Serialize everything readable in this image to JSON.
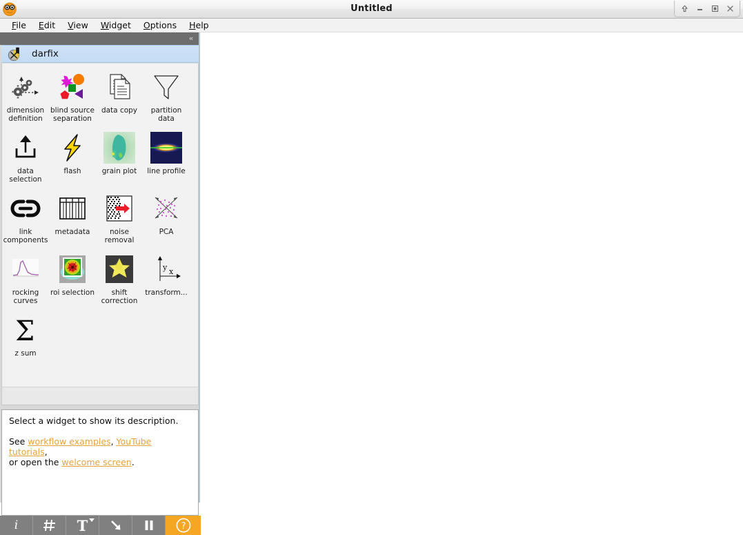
{
  "window": {
    "title": "Untitled",
    "logo_icon": "orange-canvas-smiley-icon",
    "controls": [
      {
        "name": "always-on-top-button",
        "glyph": "⬆",
        "icon": "arrow-up-icon"
      },
      {
        "name": "minimize-button",
        "glyph": "–",
        "icon": "minimize-icon"
      },
      {
        "name": "maximize-button",
        "glyph": "❒",
        "icon": "maximize-icon"
      },
      {
        "name": "close-button",
        "glyph": "✕",
        "icon": "close-icon"
      }
    ]
  },
  "menubar": {
    "items": [
      {
        "name": "menu-file",
        "mnemonic": "F",
        "rest": "ile"
      },
      {
        "name": "menu-edit",
        "mnemonic": "E",
        "rest": "dit"
      },
      {
        "name": "menu-view",
        "mnemonic": "V",
        "rest": "iew"
      },
      {
        "name": "menu-widget",
        "mnemonic": "W",
        "rest": "idget"
      },
      {
        "name": "menu-options",
        "mnemonic": "O",
        "rest": "ptions"
      },
      {
        "name": "menu-help",
        "mnemonic": "H",
        "rest": "elp"
      }
    ]
  },
  "toolbox": {
    "collapse_glyph": "«",
    "category": {
      "label": "darfix",
      "icon": "darfix-category-icon"
    },
    "widgets": [
      {
        "label": "dimension\ndefinition",
        "icon": "dimension-definition-icon"
      },
      {
        "label": "blind source\nseparation",
        "icon": "blind-source-separation-icon"
      },
      {
        "label": "data copy",
        "icon": "data-copy-icon"
      },
      {
        "label": "partition\ndata",
        "icon": "partition-data-icon"
      },
      {
        "label": "data\nselection",
        "icon": "data-selection-icon"
      },
      {
        "label": "flash",
        "icon": "flash-icon"
      },
      {
        "label": "grain plot",
        "icon": "grain-plot-icon"
      },
      {
        "label": "line profile",
        "icon": "line-profile-icon"
      },
      {
        "label": "link\ncomponents",
        "icon": "link-components-icon"
      },
      {
        "label": "metadata",
        "icon": "metadata-icon"
      },
      {
        "label": "noise\nremoval",
        "icon": "noise-removal-icon"
      },
      {
        "label": "PCA",
        "icon": "pca-icon"
      },
      {
        "label": "rocking\ncurves",
        "icon": "rocking-curves-icon"
      },
      {
        "label": "roi selection",
        "icon": "roi-selection-icon"
      },
      {
        "label": "shift\ncorrection",
        "icon": "shift-correction-icon"
      },
      {
        "label": "transform...",
        "icon": "transformation-icon"
      },
      {
        "label": "z sum",
        "icon": "z-sum-icon"
      }
    ]
  },
  "description": {
    "line1": "Select a widget to show its description.",
    "see_prefix": "See ",
    "link_workflow": "workflow examples",
    "sep1": ", ",
    "link_youtube": "YouTube tutorials",
    "sep2": ",",
    "or_prefix": "or open the ",
    "link_welcome": "welcome screen",
    "period": "."
  },
  "bottom_toolbar": {
    "buttons": [
      {
        "name": "info-button",
        "icon": "info-icon",
        "glyph": "i",
        "has_caret": false
      },
      {
        "name": "grid-button",
        "icon": "grid-icon",
        "glyph": "#",
        "has_caret": false
      },
      {
        "name": "text-annotation-button",
        "icon": "text-icon",
        "glyph": "T",
        "has_caret": true
      },
      {
        "name": "arrow-annotation-button",
        "icon": "arrow-icon",
        "glyph": "↘",
        "has_caret": true
      },
      {
        "name": "pause-button",
        "icon": "pause-icon",
        "glyph": "❚❚",
        "has_caret": false
      },
      {
        "name": "help-button",
        "icon": "question-mark-icon",
        "glyph": "?",
        "has_caret": false
      }
    ]
  },
  "colors": {
    "accent_orange": "#f5a623",
    "toolbar_grey": "#808080",
    "category_blue": "#c7ddf5",
    "link_orange": "#e8a33d"
  }
}
